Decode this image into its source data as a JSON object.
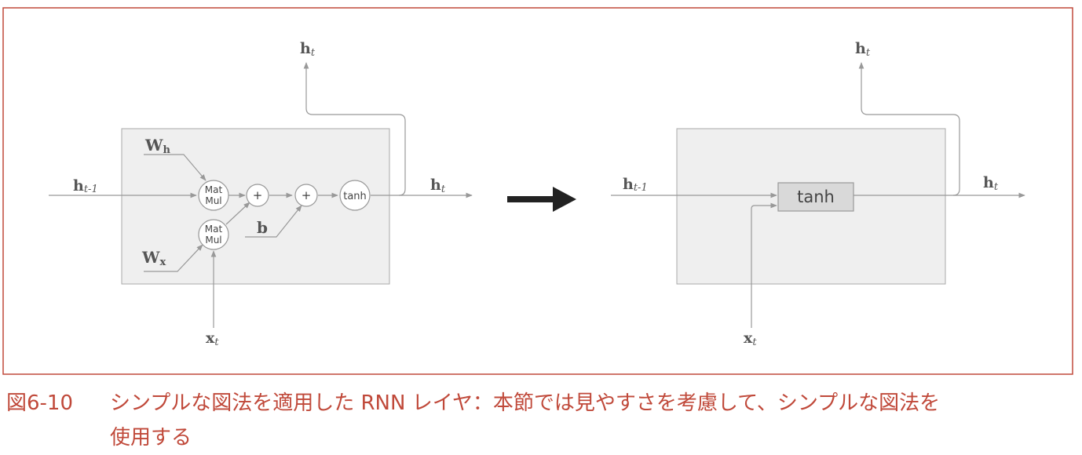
{
  "left": {
    "w_h": "W",
    "w_h_sub": "h",
    "w_x": "W",
    "w_x_sub": "x",
    "h_prev": "h",
    "h_prev_sub": "t-1",
    "h_out": "h",
    "h_out_sub": "t",
    "h_top": "h",
    "h_top_sub": "t",
    "x_in": "x",
    "x_in_sub": "t",
    "b": "b",
    "matmul_line1": "Mat",
    "matmul_line2": "Mul",
    "plus": "+",
    "tanh": "tanh"
  },
  "right": {
    "h_prev": "h",
    "h_prev_sub": "t-1",
    "h_out": "h",
    "h_out_sub": "t",
    "h_top": "h",
    "h_top_sub": "t",
    "x_in": "x",
    "x_in_sub": "t",
    "tanh": "tanh"
  },
  "caption": {
    "number": "図6-10",
    "text_line1": "シンプルな図法を適用した RNN レイヤ：本節では見やすさを考慮して、シンプルな図法を",
    "text_line2": "使用する"
  },
  "colors": {
    "frame": "#c0493a",
    "caption": "#c0493a",
    "box_fill": "#efefef",
    "line": "#999999",
    "arrow": "#222222"
  }
}
